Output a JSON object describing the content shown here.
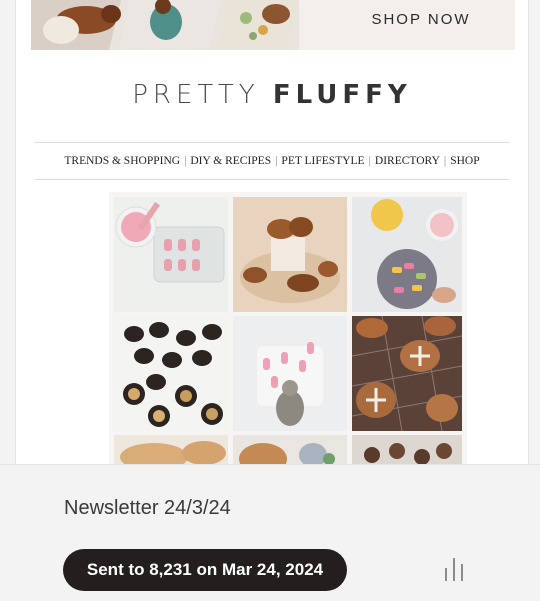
{
  "banner": {
    "cta_label": "SHOP NOW"
  },
  "brand": {
    "light": "PRETTY",
    "bold": "FLUFFY"
  },
  "nav": {
    "items": [
      "TRENDS & SHOPPING",
      "DIY & RECIPES",
      "PET LIFESTYLE",
      "DIRECTORY",
      "SHOP"
    ],
    "separator": "|"
  },
  "collage": {
    "tiles": [
      "pink-gummy-molds",
      "croissant-dog-treats",
      "colorful-biscuit-bowl",
      "carob-truffles",
      "pink-marshmallow-bunnies",
      "iced-gingerbread-cookies"
    ]
  },
  "newsletter": {
    "title": "Newsletter 24/3/24",
    "sent_label": "Sent to 8,231 on Mar 24, 2024"
  },
  "icons": {
    "stats": "bar-chart-icon"
  },
  "colors": {
    "pill_bg": "#231f1e",
    "page_bg": "#f4f3f3",
    "banner_bg": "#f3efec"
  }
}
